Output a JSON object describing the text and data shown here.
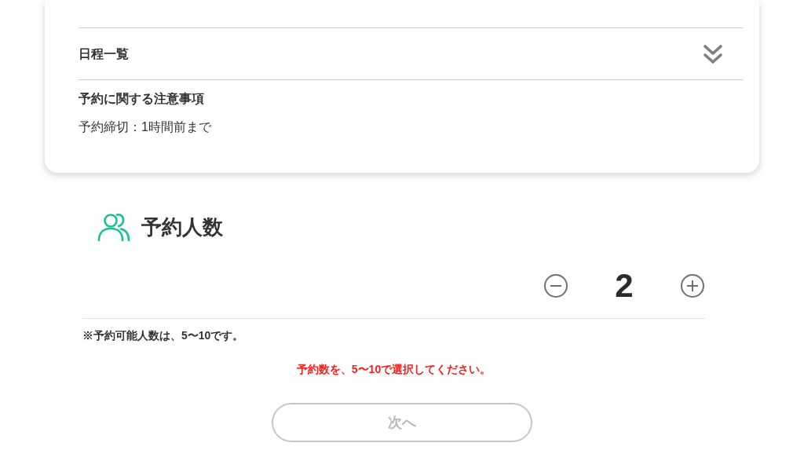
{
  "detail_card": {
    "schedule_accordion": {
      "label": "日程一覧",
      "expanded": false
    },
    "notes": {
      "heading": "予約に関する注意事項",
      "text": "予約締切：1時間前まで"
    }
  },
  "party_size": {
    "title": "予約人数",
    "count": "2",
    "range_note": "※予約可能人数は、5〜10です。",
    "error": "予約数を、5〜10で選択してください。"
  },
  "next_button": {
    "label": "次へ",
    "disabled": true
  }
}
